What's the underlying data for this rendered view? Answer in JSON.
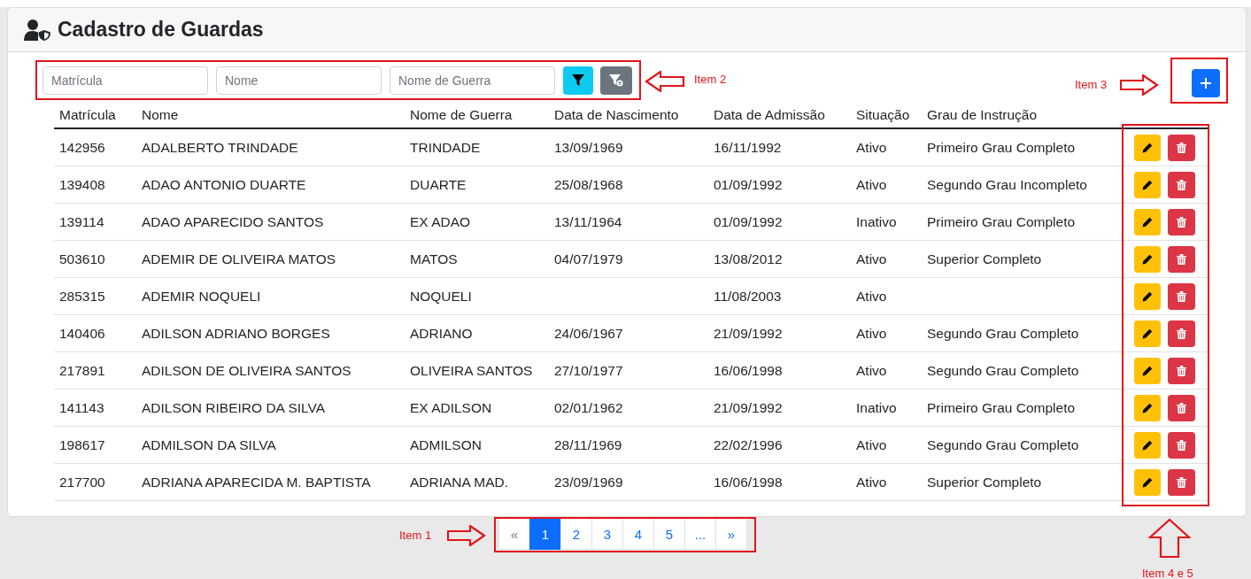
{
  "header": {
    "title": "Cadastro de Guardas"
  },
  "filters": [
    {
      "placeholder": "Matrícula"
    },
    {
      "placeholder": "Nome"
    },
    {
      "placeholder": "Nome de Guerra"
    }
  ],
  "table": {
    "columns": [
      "Matrícula",
      "Nome",
      "Nome de Guerra",
      "Data de Nascimento",
      "Data de Admissão",
      "Situação",
      "Grau de Instrução"
    ],
    "rows": [
      [
        "142956",
        "ADALBERTO TRINDADE",
        "TRINDADE",
        "13/09/1969",
        "16/11/1992",
        "Ativo",
        "Primeiro Grau Completo"
      ],
      [
        "139408",
        "ADAO ANTONIO DUARTE",
        "DUARTE",
        "25/08/1968",
        "01/09/1992",
        "Ativo",
        "Segundo Grau Incompleto"
      ],
      [
        "139114",
        "ADAO APARECIDO SANTOS",
        "EX ADAO",
        "13/11/1964",
        "01/09/1992",
        "Inativo",
        "Primeiro Grau Completo"
      ],
      [
        "503610",
        "ADEMIR DE OLIVEIRA MATOS",
        "MATOS",
        "04/07/1979",
        "13/08/2012",
        "Ativo",
        "Superior Completo"
      ],
      [
        "285315",
        "ADEMIR NOQUELI",
        "NOQUELI",
        "",
        "11/08/2003",
        "Ativo",
        ""
      ],
      [
        "140406",
        "ADILSON ADRIANO BORGES",
        "ADRIANO",
        "24/06/1967",
        "21/09/1992",
        "Ativo",
        "Segundo Grau Completo"
      ],
      [
        "217891",
        "ADILSON DE OLIVEIRA SANTOS",
        "OLIVEIRA SANTOS",
        "27/10/1977",
        "16/06/1998",
        "Ativo",
        "Segundo Grau Completo"
      ],
      [
        "141143",
        "ADILSON RIBEIRO DA SILVA",
        "EX ADILSON",
        "02/01/1962",
        "21/09/1992",
        "Inativo",
        "Primeiro Grau Completo"
      ],
      [
        "198617",
        "ADMILSON DA SILVA",
        "ADMILSON",
        "28/11/1969",
        "22/02/1996",
        "Ativo",
        "Segundo Grau Completo"
      ],
      [
        "217700",
        "ADRIANA APARECIDA M. BAPTISTA",
        "ADRIANA MAD.",
        "23/09/1969",
        "16/06/1998",
        "Ativo",
        "Superior Completo"
      ]
    ]
  },
  "pagination": [
    {
      "label": "«",
      "selected": false,
      "kind": "nav"
    },
    {
      "label": "1",
      "selected": true,
      "kind": "page"
    },
    {
      "label": "2",
      "selected": false,
      "kind": "page"
    },
    {
      "label": "3",
      "selected": false,
      "kind": "page"
    },
    {
      "label": "4",
      "selected": false,
      "kind": "page"
    },
    {
      "label": "5",
      "selected": false,
      "kind": "page"
    },
    {
      "label": "...",
      "selected": false,
      "kind": "page"
    },
    {
      "label": "»",
      "selected": false,
      "kind": "page"
    }
  ],
  "annotations": [
    {
      "label": "Item 2",
      "kind": "left"
    },
    {
      "label": "Item 3",
      "kind": "right"
    },
    {
      "label": "Item 1",
      "kind": "right"
    },
    {
      "label": "Item 4 e 5",
      "kind": "up"
    }
  ]
}
